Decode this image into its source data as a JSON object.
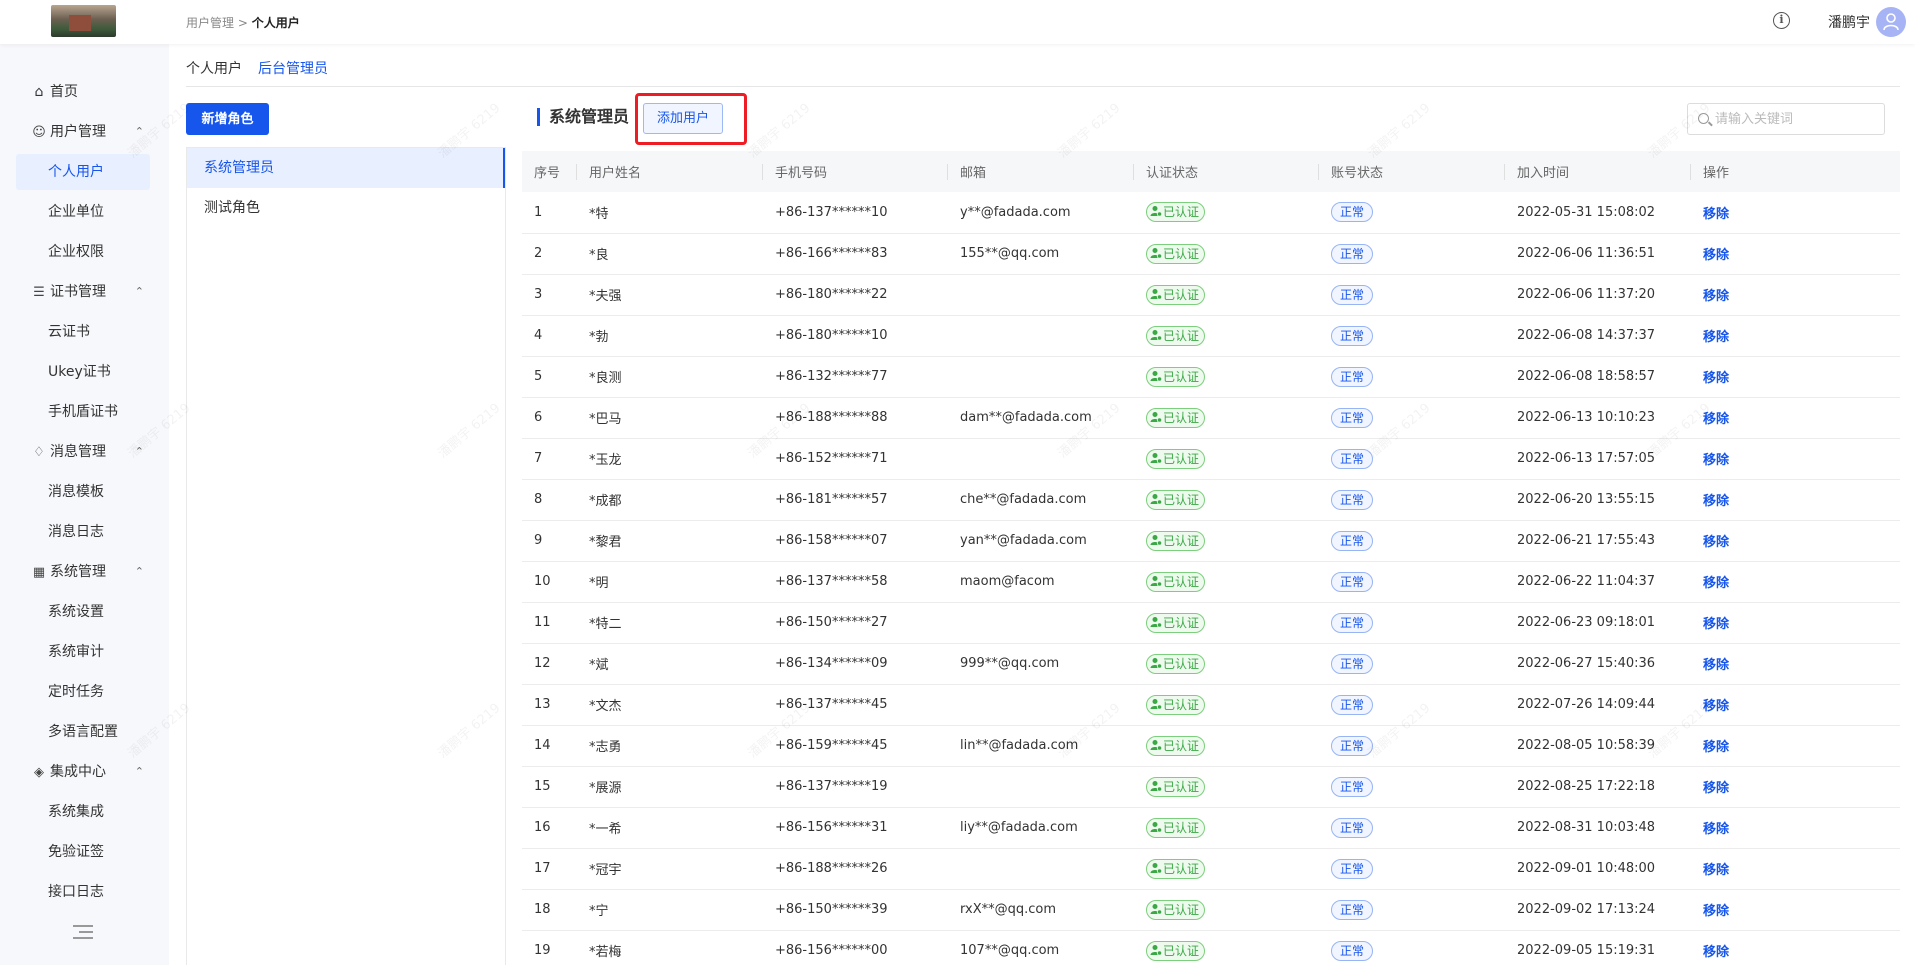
{
  "header": {
    "breadcrumb_parent": "用户管理",
    "breadcrumb_sep": ">",
    "breadcrumb_current": "个人用户",
    "username": "潘鹏宇"
  },
  "sidebar": {
    "home": "首页",
    "groups": [
      {
        "label": "用户管理",
        "icon": "users-icon",
        "items": [
          "个人用户",
          "企业单位",
          "企业权限"
        ]
      },
      {
        "label": "证书管理",
        "icon": "document-icon",
        "items": [
          "云证书",
          "Ukey证书",
          "手机盾证书"
        ]
      },
      {
        "label": "消息管理",
        "icon": "bell-icon",
        "items": [
          "消息模板",
          "消息日志"
        ]
      },
      {
        "label": "系统管理",
        "icon": "layout-icon",
        "items": [
          "系统设置",
          "系统审计",
          "定时任务",
          "多语言配置"
        ]
      },
      {
        "label": "集成中心",
        "icon": "layers-icon",
        "items": [
          "系统集成",
          "免验证签",
          "接口日志"
        ]
      }
    ]
  },
  "tabs": [
    "个人用户",
    "后台管理员"
  ],
  "roles": {
    "new_button": "新增角色",
    "items": [
      "系统管理员",
      "测试角色"
    ]
  },
  "main": {
    "title": "系统管理员",
    "add_button": "添加用户",
    "search_placeholder": "请输入关键词"
  },
  "table": {
    "headers": [
      "序号",
      "用户姓名",
      "手机号码",
      "邮箱",
      "认证状态",
      "账号状态",
      "加入时间",
      "操作"
    ],
    "auth_label": "已认证",
    "status_label": "正常",
    "action_label": "移除",
    "rows": [
      {
        "no": "1",
        "name": "*特",
        "phone": "+86-137******10",
        "email": "y**@fadada.com",
        "time": "2022-05-31 15:08:02"
      },
      {
        "no": "2",
        "name": "*良",
        "phone": "+86-166******83",
        "email": "155**@qq.com",
        "time": "2022-06-06 11:36:51"
      },
      {
        "no": "3",
        "name": "*夫强",
        "phone": "+86-180******22",
        "email": "",
        "time": "2022-06-06 11:37:20"
      },
      {
        "no": "4",
        "name": "*勃",
        "phone": "+86-180******10",
        "email": "",
        "time": "2022-06-08 14:37:37"
      },
      {
        "no": "5",
        "name": "*良测",
        "phone": "+86-132******77",
        "email": "",
        "time": "2022-06-08 18:58:57"
      },
      {
        "no": "6",
        "name": "*巴马",
        "phone": "+86-188******88",
        "email": "dam**@fadada.com",
        "time": "2022-06-13 10:10:23"
      },
      {
        "no": "7",
        "name": "*玉龙",
        "phone": "+86-152******71",
        "email": "",
        "time": "2022-06-13 17:57:05"
      },
      {
        "no": "8",
        "name": "*成都",
        "phone": "+86-181******57",
        "email": "che**@fadada.com",
        "time": "2022-06-20 13:55:15"
      },
      {
        "no": "9",
        "name": "*黎君",
        "phone": "+86-158******07",
        "email": "yan**@fadada.com",
        "time": "2022-06-21 17:55:43"
      },
      {
        "no": "10",
        "name": "*明",
        "phone": "+86-137******58",
        "email": "maom@facom",
        "time": "2022-06-22 11:04:37"
      },
      {
        "no": "11",
        "name": "*特二",
        "phone": "+86-150******27",
        "email": "",
        "time": "2022-06-23 09:18:01"
      },
      {
        "no": "12",
        "name": "*斌",
        "phone": "+86-134******09",
        "email": "999**@qq.com",
        "time": "2022-06-27 15:40:36"
      },
      {
        "no": "13",
        "name": "*文杰",
        "phone": "+86-137******45",
        "email": "",
        "time": "2022-07-26 14:09:44"
      },
      {
        "no": "14",
        "name": "*志勇",
        "phone": "+86-159******45",
        "email": "lin**@fadada.com",
        "time": "2022-08-05 10:58:39"
      },
      {
        "no": "15",
        "name": "*展源",
        "phone": "+86-137******19",
        "email": "",
        "time": "2022-08-25 17:22:18"
      },
      {
        "no": "16",
        "name": "*一希",
        "phone": "+86-156******31",
        "email": "liy**@fadada.com",
        "time": "2022-08-31 10:03:48"
      },
      {
        "no": "17",
        "name": "*冠宇",
        "phone": "+86-188******26",
        "email": "",
        "time": "2022-09-01 10:48:00"
      },
      {
        "no": "18",
        "name": "*宁",
        "phone": "+86-150******39",
        "email": "rxX**@qq.com",
        "time": "2022-09-02 17:13:24"
      },
      {
        "no": "19",
        "name": "*若梅",
        "phone": "+86-156******00",
        "email": "107**@qq.com",
        "time": "2022-09-05 15:19:31"
      }
    ]
  },
  "watermark": "潘鹏宇 6219",
  "colors": {
    "accent": "#1756ec",
    "success": "#3aa845",
    "highlight": "#ee1c25"
  }
}
